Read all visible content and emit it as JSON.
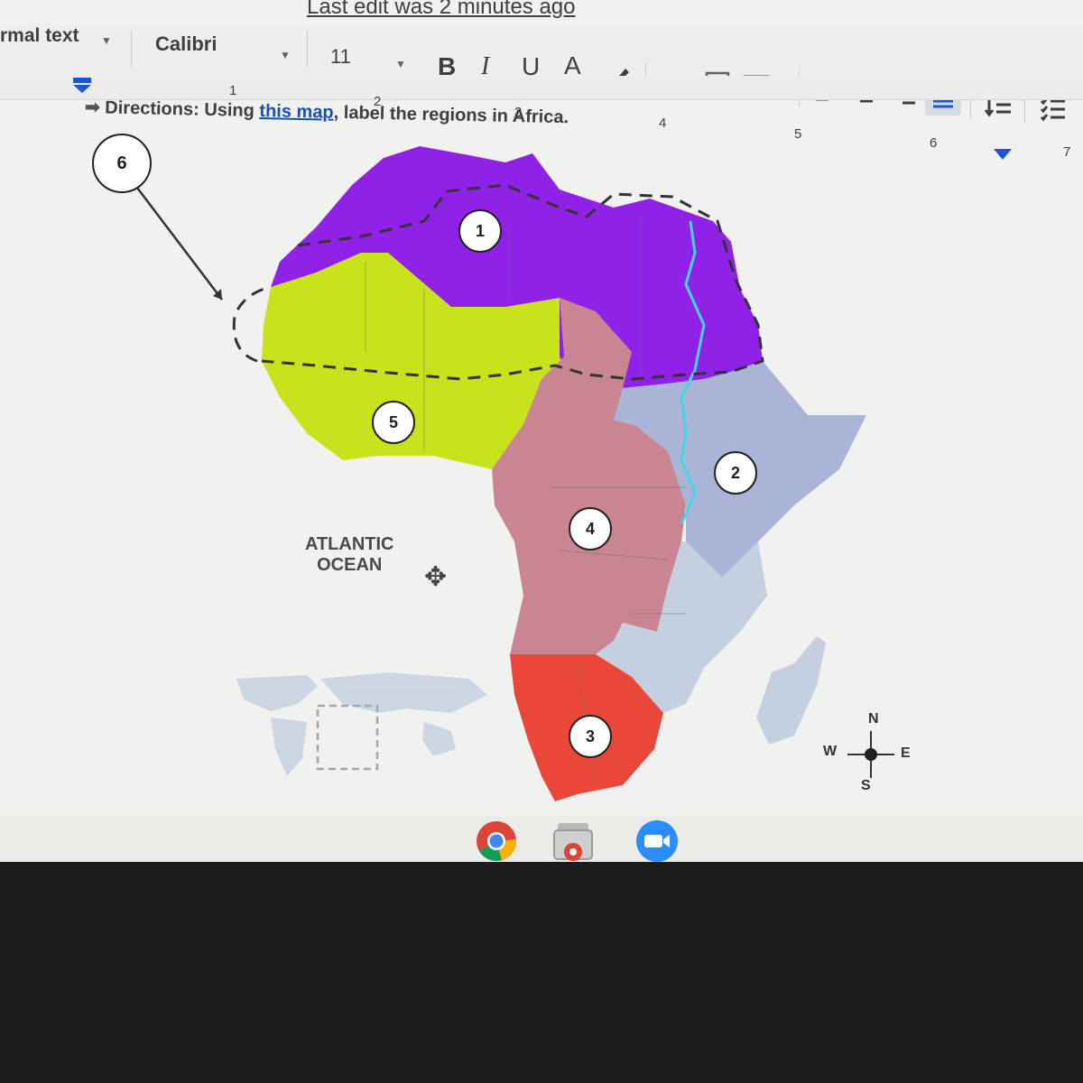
{
  "doc": {
    "last_edit": "Last edit was 2 minutes ago"
  },
  "toolbar": {
    "style": "rmal text",
    "font": "Calibri",
    "size": "11",
    "bold": "B",
    "italic": "I",
    "underline": "U",
    "text_color": "A"
  },
  "ruler": {
    "numbers": [
      "1",
      "2",
      "3",
      "4",
      "5",
      "6",
      "7"
    ]
  },
  "directions": {
    "prefix": "Directions:",
    "text1": "Using",
    "link": "this map",
    "text2": ", label the regions in Africa."
  },
  "map": {
    "labels": [
      "1",
      "2",
      "3",
      "4",
      "5",
      "6"
    ],
    "ocean_line1": "ATLANTIC",
    "ocean_line2": "OCEAN",
    "move_icon": "✥",
    "compass": {
      "n": "N",
      "s": "S",
      "e": "E",
      "w": "W"
    },
    "region_colors": {
      "north": "#8f22e6",
      "east": "#a9b4d6",
      "south": "#e8473a",
      "central": "#c98591",
      "west": "#c8e21c",
      "southern_east": "#c4cfe0"
    },
    "river_color": "#40d6e6"
  },
  "dock": {
    "apps": [
      "chrome-icon",
      "slides-icon",
      "zoom-icon"
    ]
  }
}
